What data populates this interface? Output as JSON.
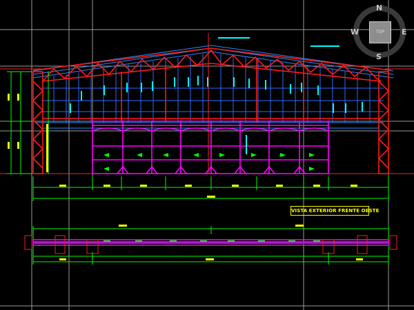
{
  "drawing": {
    "title_label": "VISTA EXTERIOR FRENTE OESTE",
    "colors": {
      "background": "#000000",
      "structure": "#ff0000",
      "door": "#ff00ff",
      "dimension": "#00ff00",
      "cladding": "#1e90ff",
      "annotation": "#00ffff",
      "label": "#ffff00",
      "reference_line": "#ffffff"
    }
  },
  "viewcube": {
    "north": "N",
    "south": "S",
    "east": "E",
    "west": "W",
    "top": "TOP"
  }
}
